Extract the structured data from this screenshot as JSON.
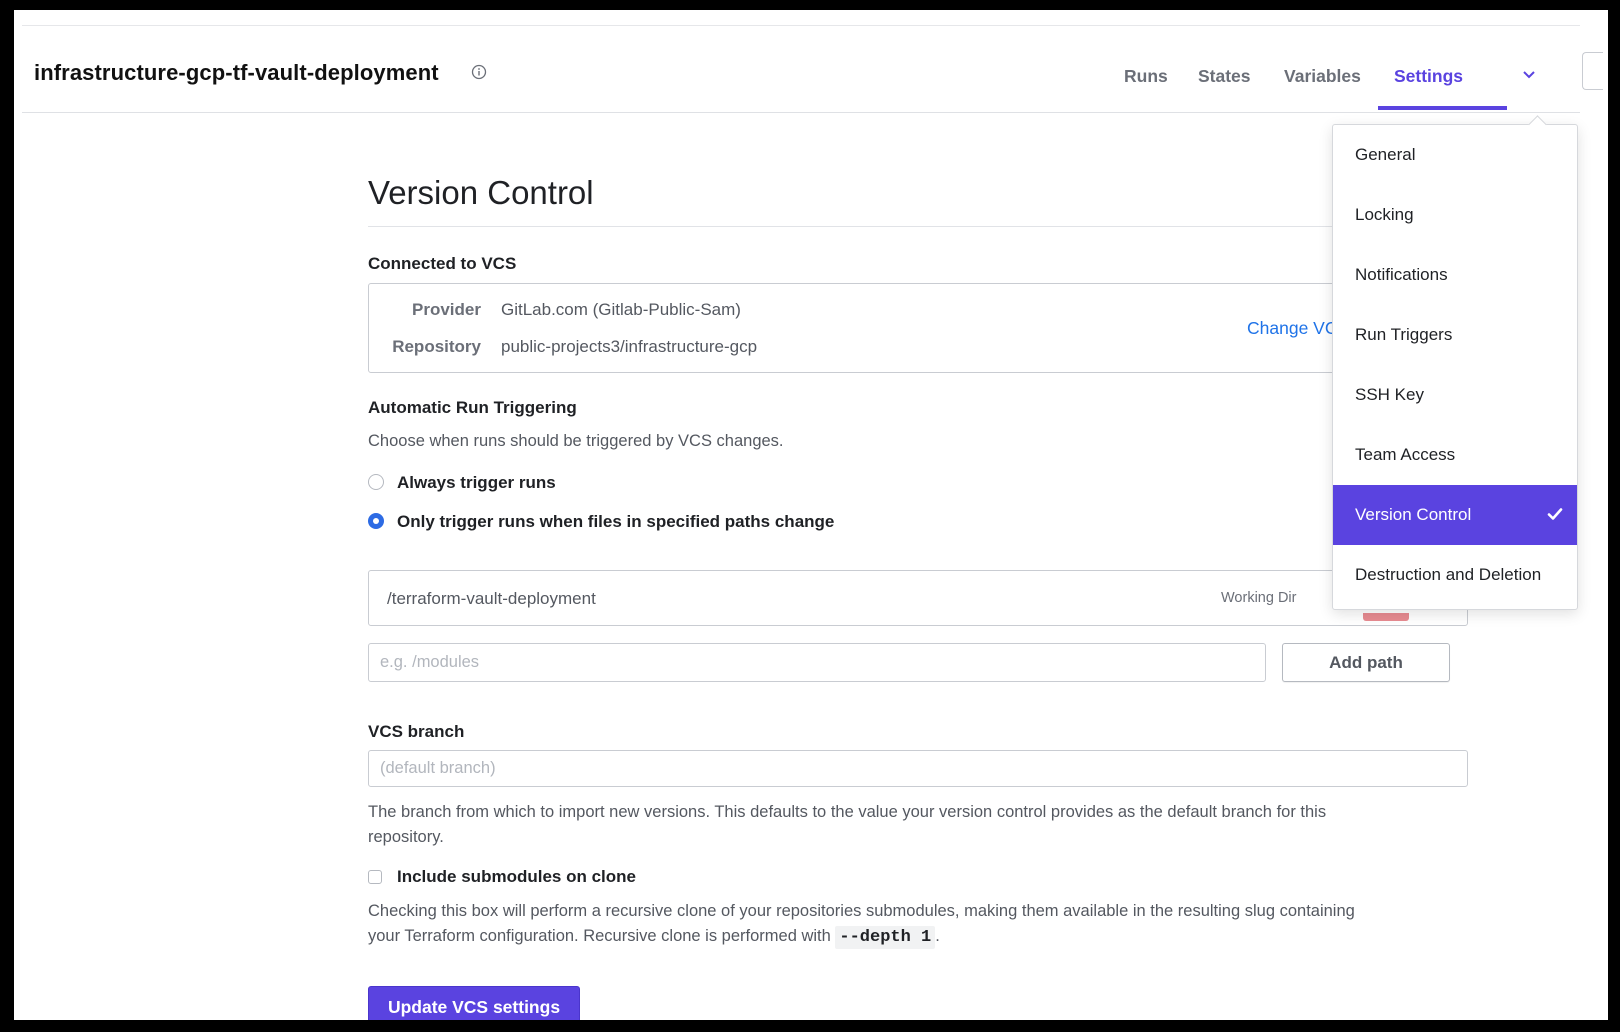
{
  "workspace": {
    "title": "infrastructure-gcp-tf-vault-deployment"
  },
  "nav": {
    "runs": "Runs",
    "states": "States",
    "variables": "Variables",
    "settings": "Settings"
  },
  "page": {
    "title": "Version Control",
    "connected_label": "Connected to VCS",
    "provider_key": "Provider",
    "provider_value": "GitLab.com (Gitlab-Public-Sam)",
    "repository_key": "Repository",
    "repository_value": "public-projects3/infrastructure-gcp",
    "change_vcs": "Change VC"
  },
  "triggering": {
    "label": "Automatic Run Triggering",
    "description": "Choose when runs should be triggered by VCS changes.",
    "option_always": "Always trigger runs",
    "option_paths": "Only trigger runs when files in specified paths change",
    "selected": "option_paths",
    "path_value": "/terraform-vault-deployment",
    "path_tag": "Working Dir",
    "path_placeholder": "e.g. /modules",
    "add_path": "Add path"
  },
  "branch": {
    "label": "VCS branch",
    "placeholder": "(default branch)",
    "help_line1": "The branch from which to import new versions. This defaults to the value your version control provides as the default branch for this",
    "help_line2": "repository."
  },
  "submodules": {
    "label": "Include submodules on clone",
    "checked": false,
    "help_line1": "Checking this box will perform a recursive clone of your repositories submodules, making them available in the resulting slug containing",
    "help_line2_prefix": "your Terraform configuration. Recursive clone is performed with",
    "help_code": "--depth 1",
    "help_suffix": "."
  },
  "submit": "Update VCS settings",
  "dropdown": {
    "items": [
      "General",
      "Locking",
      "Notifications",
      "Run Triggers",
      "SSH Key",
      "Team Access",
      "Version Control",
      "Destruction and Deletion"
    ],
    "selected_index": 6
  },
  "colors": {
    "accent": "#5a43e0",
    "link": "#1f73e8",
    "radio_on": "#2d6be4",
    "danger": "#e88b91"
  }
}
